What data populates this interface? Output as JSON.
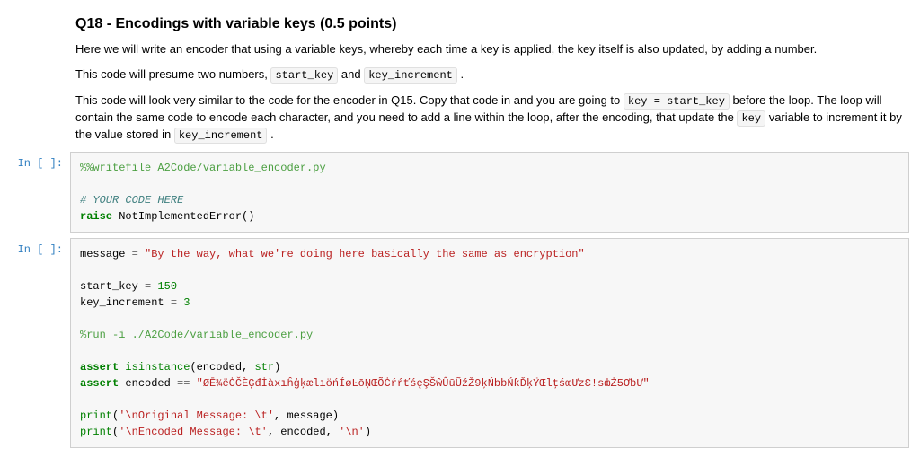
{
  "heading": {
    "text": "Q18 - Encodings with variable keys (0.5 points)"
  },
  "paragraphs": {
    "p1": "Here we will write an encoder that using a variable keys, whereby each time a key is applied, the key itself is also updated, by adding a number.",
    "p2a": "This code will presume two numbers, ",
    "p2b": " and ",
    "p2c": ".",
    "p3a": "This code will look very similar to the code for the encoder in Q15. Copy that code in and you are going to ",
    "p3b": " before the loop. The loop will contain the same code to encode each character, and you need to add a line within the loop, after the encoding, that update the ",
    "p3c": " variable to increment it by the value stored in ",
    "p3d": "."
  },
  "inline_codes": {
    "start_key": "start_key",
    "key_increment": "key_increment",
    "key_assign": "key = start_key",
    "key": "key"
  },
  "cells": [
    {
      "prompt": "In [ ]:",
      "lines": {
        "l1": "%%writefile A2Code/variable_encoder.py",
        "l3": "# YOUR CODE HERE",
        "raise": "raise",
        "err": "NotImplementedError()"
      }
    },
    {
      "prompt": "In [ ]:",
      "values": {
        "message_str": "\"By the way, what we're doing here basically the same as encryption\"",
        "start_key": "150",
        "key_increment": "3",
        "run_line": "%run -i ./A2Code/variable_encoder.py",
        "expected_str": "\"ØĒ¾ëĊČÈĢđİàxıĥģķælıöńÍøĿōŅŒÕĊŕŕťśęŞŠŵÛūŨźŽ9ķŃbbŃƙĎķŸŒlţśœƯzƐ!sȸŻ5ƠƅƯ\"",
        "print1": "'\\nOriginal Message: \\t'",
        "print2": "'\\nEncoded Message: \\t'",
        "newline": "'\\n'"
      }
    }
  ]
}
